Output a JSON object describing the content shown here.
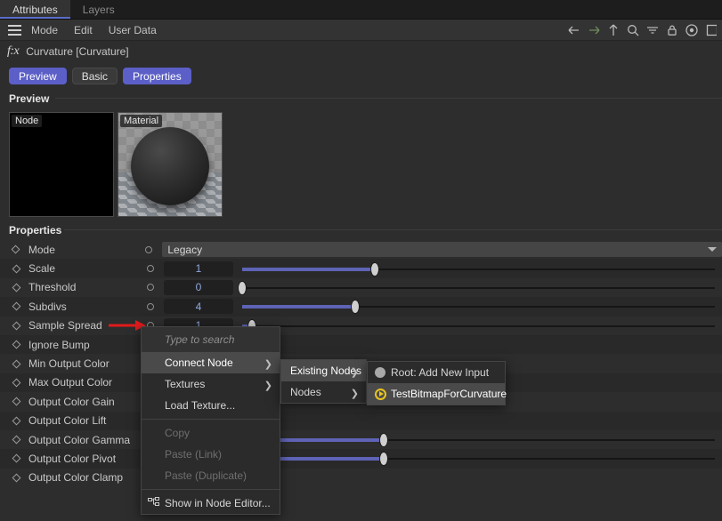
{
  "window": {
    "tabs": [
      {
        "label": "Attributes",
        "active": true
      },
      {
        "label": "Layers",
        "active": false
      }
    ],
    "menus": [
      "Mode",
      "Edit",
      "User Data"
    ],
    "toolbar_icons": [
      "back-arrow-icon",
      "forward-arrow-icon",
      "up-arrow-icon",
      "search-icon",
      "filter-icon",
      "lock-icon",
      "target-icon",
      "panel-icon"
    ]
  },
  "node": {
    "fx_label": "f:x",
    "title": "Curvature [Curvature]",
    "segments": [
      {
        "label": "Preview",
        "active": true
      },
      {
        "label": "Basic",
        "active": false
      },
      {
        "label": "Properties",
        "active": true
      }
    ]
  },
  "preview": {
    "section_title": "Preview",
    "thumbnails": [
      {
        "label": "Node"
      },
      {
        "label": "Material"
      }
    ]
  },
  "properties": {
    "section_title": "Properties",
    "rows": [
      {
        "label": "Mode",
        "type": "dropdown",
        "value": "Legacy"
      },
      {
        "label": "Scale",
        "type": "slider",
        "value": "1",
        "fill": 28,
        "handle": 28
      },
      {
        "label": "Threshold",
        "type": "slider",
        "value": "0",
        "fill": 0,
        "handle": 0
      },
      {
        "label": "Subdivs",
        "type": "slider",
        "value": "4",
        "fill": 24,
        "handle": 24
      },
      {
        "label": "Sample Spread",
        "type": "slider",
        "value": "1",
        "fill": 2,
        "handle": 2
      },
      {
        "label": "Ignore Bump",
        "type": "checkbox",
        "value": ""
      },
      {
        "label": "Min Output Color",
        "type": "color",
        "value": ""
      },
      {
        "label": "Max Output Color",
        "type": "color",
        "value": ""
      },
      {
        "label": "Output Color Gain",
        "type": "color",
        "value": ""
      },
      {
        "label": "Output Color Lift",
        "type": "color",
        "value": ""
      },
      {
        "label": "Output Color Gamma",
        "type": "slider",
        "value": "",
        "fill": 30,
        "handle": 30
      },
      {
        "label": "Output Color Pivot",
        "type": "slider",
        "value": "",
        "fill": 30,
        "handle": 30
      },
      {
        "label": "Output Color Clamp",
        "type": "checkbox",
        "value": ""
      }
    ]
  },
  "context_menu": {
    "search_placeholder": "Type to search",
    "items": [
      {
        "label": "Connect Node",
        "highlighted": true,
        "submenu": true,
        "disabled": false
      },
      {
        "label": "Textures",
        "highlighted": false,
        "submenu": true,
        "disabled": false
      },
      {
        "label": "Load Texture...",
        "highlighted": false,
        "submenu": false,
        "disabled": false
      },
      {
        "label": "Copy",
        "highlighted": false,
        "submenu": false,
        "disabled": true
      },
      {
        "label": "Paste (Link)",
        "highlighted": false,
        "submenu": false,
        "disabled": true
      },
      {
        "label": "Paste (Duplicate)",
        "highlighted": false,
        "submenu": false,
        "disabled": true
      },
      {
        "label": "Show in Node Editor...",
        "highlighted": false,
        "submenu": false,
        "disabled": false,
        "icon": "node-editor-icon"
      }
    ]
  },
  "submenu": {
    "items": [
      {
        "label": "Existing Nodes",
        "highlighted": true,
        "submenu": true
      },
      {
        "label": "Nodes",
        "highlighted": false,
        "submenu": true
      }
    ]
  },
  "node_list": {
    "items": [
      {
        "label": "Root: Add New Input",
        "icon": "gray-circle-icon",
        "highlighted": false
      },
      {
        "label": "TestBitmapForCurvature",
        "icon": "play-circle-icon",
        "highlighted": true
      }
    ]
  },
  "annotation": {
    "arrow": "red-arrow-pointing-right",
    "color": "#e01b1b"
  },
  "colors": {
    "accent": "#5b5fc7",
    "slider_fill": "#5e63b6",
    "value_text": "#8fa8dd",
    "highlight_yellow": "#e8c420"
  }
}
